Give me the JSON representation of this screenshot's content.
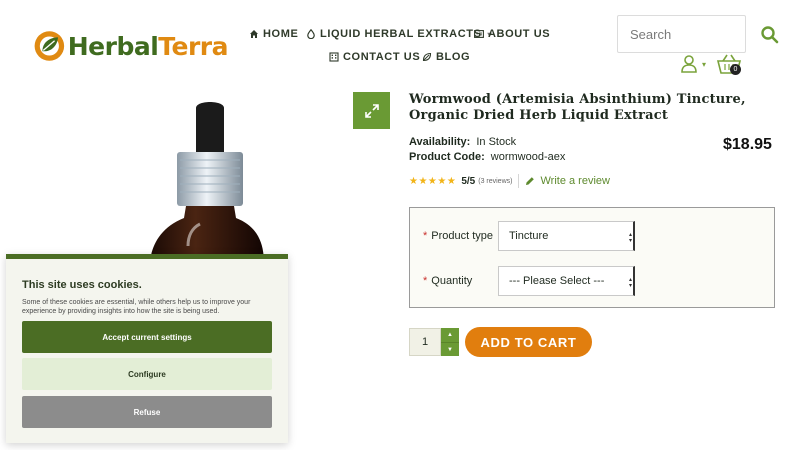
{
  "brand": {
    "part1": "Herbal",
    "part2": "Terra"
  },
  "nav": {
    "home": "HOME",
    "extracts": "LIQUID HERBAL EXTRACTS",
    "about": "ABOUT US",
    "contact": "CONTACT US",
    "blog": "BLOG"
  },
  "search": {
    "placeholder": "Search"
  },
  "cart": {
    "count": "0"
  },
  "product": {
    "title": "Wormwood (Artemisia Absinthium) Tincture, Organic Dried Herb Liquid Extract",
    "availability_label": "Availability:",
    "availability_value": "In Stock",
    "code_label": "Product Code:",
    "code_value": "wormwood-aex",
    "price": "$18.95",
    "stars": "★★★★★",
    "rating": "5/5",
    "reviews": "(3 reviews)",
    "write_review": "Write a review"
  },
  "options": {
    "product_type_label": "Product type",
    "product_type_value": "Tincture",
    "quantity_label": "Quantity",
    "quantity_value": "--- Please Select ---",
    "required_mark": "*"
  },
  "purchase": {
    "qty": "1",
    "add_to_cart": "ADD TO CART"
  },
  "cookie": {
    "title": "This site uses cookies.",
    "text": "Some of these cookies are essential, while others help us to improve your experience by providing insights into how the site is being used.",
    "accept": "Accept current settings",
    "configure": "Configure",
    "refuse": "Refuse"
  },
  "colors": {
    "accent_green": "#6a9a34",
    "dark_green": "#4b6d24",
    "orange": "#e17e0e",
    "star_yellow": "#f2b418"
  },
  "icons": [
    "home-icon",
    "drop-icon",
    "id-card-icon",
    "building-icon",
    "leaf-icon",
    "search-icon",
    "user-icon",
    "basket-icon",
    "expand-icon",
    "pencil-icon"
  ]
}
